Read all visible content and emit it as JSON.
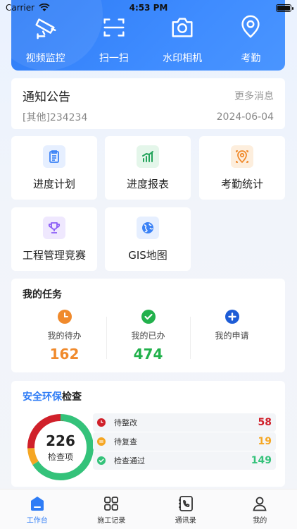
{
  "status": {
    "carrier": "Carrier",
    "time": "4:53 PM"
  },
  "hero": {
    "items": [
      {
        "label": "视频监控",
        "icon": "camera-cctv-icon"
      },
      {
        "label": "扫一扫",
        "icon": "scan-icon"
      },
      {
        "label": "水印相机",
        "icon": "photo-camera-icon"
      },
      {
        "label": "考勤",
        "icon": "location-pin-icon"
      }
    ]
  },
  "notice": {
    "title": "通知公告",
    "more": "更多消息",
    "latest": "[其他]234234",
    "date": "2024-06-04"
  },
  "tiles": [
    {
      "label": "进度计划",
      "icon": "clipboard-icon",
      "color": "#3b82f6",
      "bg": "#e6efff"
    },
    {
      "label": "进度报表",
      "icon": "bar-chart-icon",
      "color": "#22a35a",
      "bg": "#e4f6ea"
    },
    {
      "label": "考勤统计",
      "icon": "location-check-icon",
      "color": "#f08a2c",
      "bg": "#fdeedd"
    },
    {
      "label": "工程管理竞赛",
      "icon": "trophy-icon",
      "color": "#8b5cf6",
      "bg": "#efe8fe"
    },
    {
      "label": "GIS地图",
      "icon": "globe-icon",
      "color": "#3b82f6",
      "bg": "#e6efff"
    }
  ],
  "tasks": {
    "title": "我的任务",
    "items": [
      {
        "label": "我的待办",
        "count": "162",
        "color": "#f08a2c",
        "icon": "clock-icon"
      },
      {
        "label": "我的已办",
        "count": "474",
        "color": "#22b14c",
        "icon": "check-circle-icon"
      },
      {
        "label": "我的申请",
        "count": "",
        "color": "#2e7cf6",
        "icon": "plus-circle-icon"
      }
    ]
  },
  "safety": {
    "title_highlight": "安全环保",
    "title_rest": "检查",
    "total": "226",
    "total_label": "检查项",
    "items": [
      {
        "label": "待整改",
        "count": "58",
        "value": 58,
        "color": "#d0202a",
        "icon": "clock-icon"
      },
      {
        "label": "待复查",
        "count": "19",
        "value": 19,
        "color": "#f5a623",
        "icon": "minus-circle-icon"
      },
      {
        "label": "检查通过",
        "count": "149",
        "value": 149,
        "color": "#34c27a",
        "icon": "check-circle-icon"
      }
    ]
  },
  "tabs": [
    {
      "label": "工作台",
      "icon": "home-icon",
      "active": true
    },
    {
      "label": "施工记录",
      "icon": "grid-icon",
      "active": false
    },
    {
      "label": "通讯录",
      "icon": "phone-book-icon",
      "active": false
    },
    {
      "label": "我的",
      "icon": "user-icon",
      "active": false
    }
  ]
}
